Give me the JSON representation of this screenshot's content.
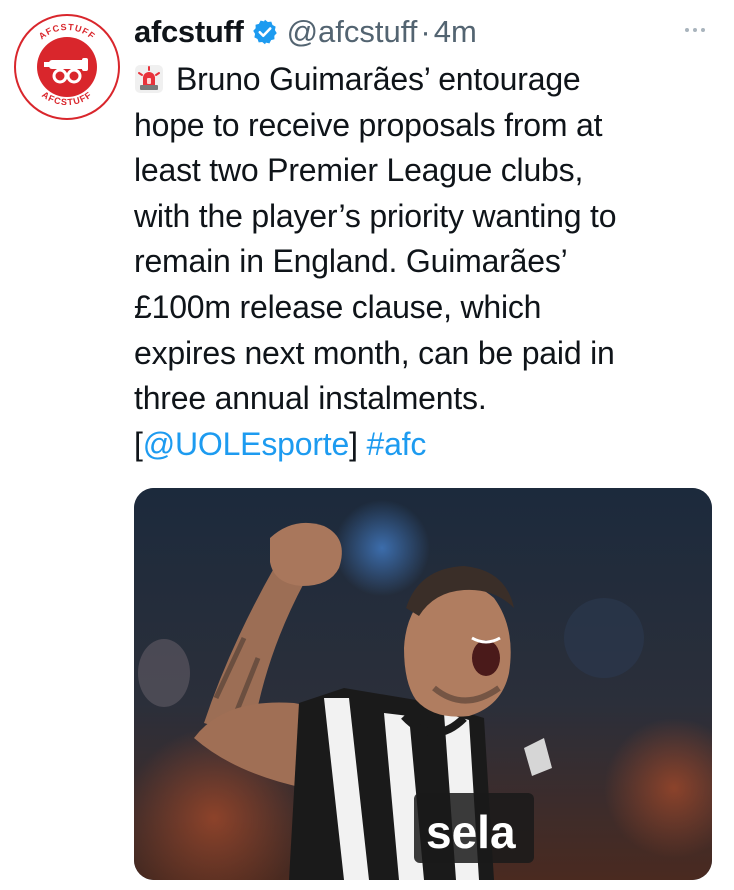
{
  "tweet": {
    "display_name": "afcstuff",
    "handle": "@afcstuff",
    "separator": "·",
    "time": "4m",
    "verified_icon": "verified-badge-icon",
    "more_icon": "more-options-icon",
    "avatar": {
      "top_text": "AFCSTUFF",
      "bottom_text": "AFCSTUFF",
      "color": "#d9262c"
    },
    "text_lines": [
      "Bruno Guimarães’ entourage",
      "hope to receive proposals from at",
      "least two Premier League clubs,",
      "with the player’s priority wanting to",
      "remain in England. Guimarães’",
      "£100m release clause, which",
      "expires next month, can be paid in",
      "three annual instalments."
    ],
    "source_open": "[",
    "source_link": "@UOLEsporte",
    "source_close": "]",
    "hashtag": "#afc",
    "lead_icon": "siren-emoji-icon",
    "media": {
      "shirt_sponsor": "sela",
      "description_icon": "photo-player-celebrating"
    }
  },
  "colors": {
    "text": "#0f1419",
    "secondary": "#536471",
    "link": "#1d9bf0",
    "brand_red": "#d9262c"
  }
}
